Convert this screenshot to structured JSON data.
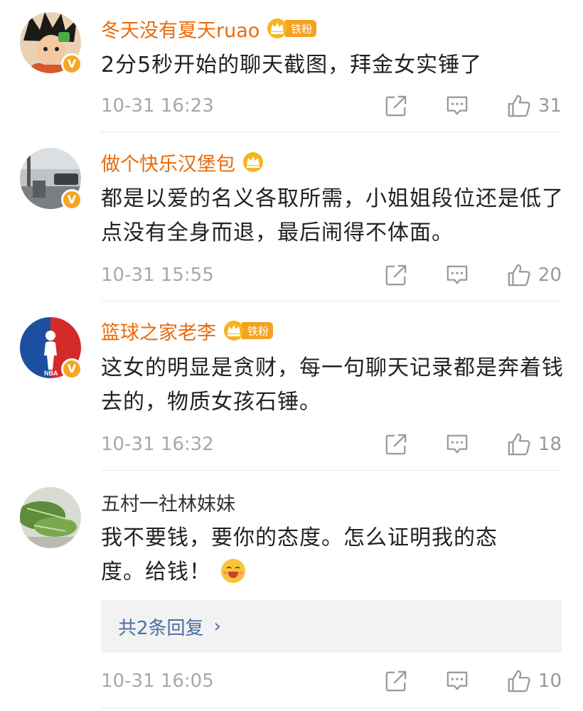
{
  "comments": [
    {
      "username": "冬天没有夏天ruao",
      "fan_tag": "铁粉",
      "crown_level": "6",
      "verified": "V",
      "text": "2分5秒开始的聊天截图，拜金女实锤了",
      "time": "10-31 16:23",
      "likes": "31"
    },
    {
      "username": "做个快乐汉堡包",
      "crown_level": "6",
      "verified": "V",
      "text": "都是以爱的名义各取所需，小姐姐段位还是低了点没有全身而退，最后闹得不体面。",
      "time": "10-31 15:55",
      "likes": "20"
    },
    {
      "username": "篮球之家老李",
      "fan_tag": "铁粉",
      "crown_level": "6",
      "verified": "V",
      "avatar_text": "NBA",
      "text": "这女的明显是贪财，每一句聊天记录都是奔着钱去的，物质女孩石锤。",
      "time": "10-31 16:32",
      "likes": "18"
    },
    {
      "username": "五村一社林妹妹",
      "text_line1": "我不要钱，要你的态度。怎么证明我的态",
      "text_line2": "度。给钱！",
      "replies": "共2条回复",
      "replies_chevron": "›",
      "time": "10-31 16:05",
      "likes": "10"
    }
  ],
  "icons": {
    "share": "share-icon",
    "comment": "comment-icon",
    "like": "thumbs-up-icon"
  },
  "colors": {
    "username_orange": "#e86b0c",
    "verified_badge": "#f5a623",
    "link_blue": "#4a6fa5",
    "meta_gray": "#a8a8a8"
  }
}
